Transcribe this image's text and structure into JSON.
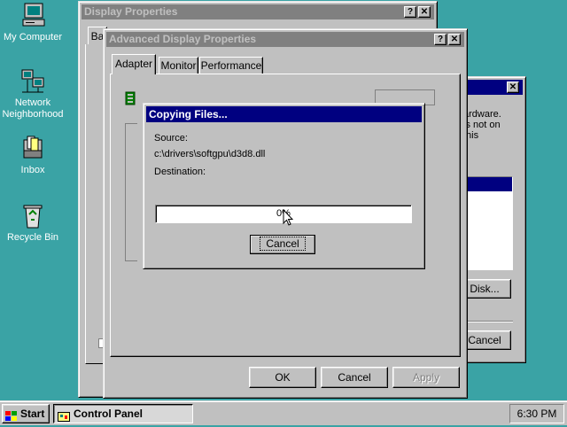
{
  "desktop": {
    "icons": [
      {
        "label": "My Computer"
      },
      {
        "label": "Network Neighborhood"
      },
      {
        "label": "Inbox"
      },
      {
        "label": "Recycle Bin"
      }
    ]
  },
  "display_properties": {
    "title": "Display Properties",
    "tab_fragment": "Ba",
    "help_glyph": "?",
    "close_glyph": "✕"
  },
  "advanced": {
    "title": "Advanced Display Properties",
    "tabs": [
      {
        "label": "Adapter"
      },
      {
        "label": "Monitor"
      },
      {
        "label": "Performance"
      }
    ],
    "ok_label": "OK",
    "cancel_label": "Cancel",
    "apply_label": "Apply"
  },
  "right_dialog": {
    "text_line1": "ardware.",
    "text_line2": "is not on",
    "text_line3": "this",
    "disk_button": "Disk...",
    "cancel_button": "Cancel"
  },
  "copying": {
    "title": "Copying Files...",
    "source_label": "Source:",
    "source_path": "c:\\drivers\\softgpu\\d3d8.dll",
    "destination_label": "Destination:",
    "progress_percent": 0,
    "progress_text": "0%",
    "cancel_label": "Cancel"
  },
  "taskbar": {
    "start_label": "Start",
    "task_label": "Control Panel",
    "clock": "6:30 PM"
  }
}
